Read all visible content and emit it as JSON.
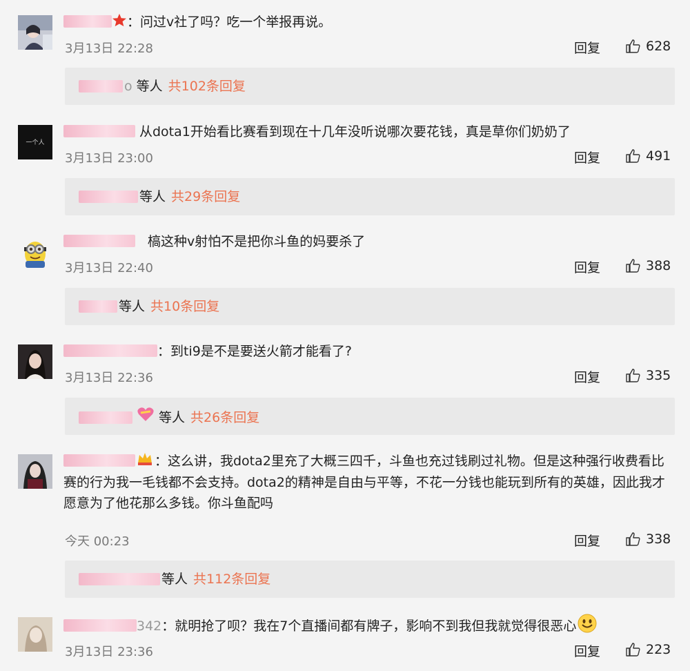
{
  "comments": [
    {
      "text": "：问过v社了吗？吃一个举报再说。",
      "time": "3月13日 22:28",
      "reply": "回复",
      "likes": "628",
      "sub_tail": "o",
      "sub_waiting": "等人",
      "sub_count": "共102条回复"
    },
    {
      "text": "从dota1开始看比赛看到现在十几年没听说哪次要花钱，真是草你们奶奶了",
      "time": "3月13日 23:00",
      "reply": "回复",
      "likes": "491",
      "sub_waiting": "等人",
      "sub_count": "共29条回复"
    },
    {
      "text": "槁这种v射怕不是把你斗鱼的妈要杀了",
      "time": "3月13日 22:40",
      "reply": "回复",
      "likes": "388",
      "sub_waiting": "等人",
      "sub_count": "共10条回复"
    },
    {
      "text": "：到ti9是不是要送火箭才能看了?",
      "time": "3月13日 22:36",
      "reply": "回复",
      "likes": "335",
      "sub_waiting": "等人",
      "sub_count": "共26条回复"
    },
    {
      "text": "：这么讲，我dota2里充了大概三四千，斗鱼也充过钱刷过礼物。但是这种强行收费看比赛的行为我一毛钱都不会支持。dota2的精神是自由与平等，不花一分钱也能玩到所有的英雄，因此我才愿意为了他花那么多钱。你斗鱼配吗",
      "time": "今天 00:23",
      "reply": "回复",
      "likes": "338",
      "sub_waiting": "等人",
      "sub_count": "共112条回复"
    },
    {
      "name_tail": "342",
      "text": "：就明抢了呗？我在7个直播间都有牌子，影响不到我但我就觉得很恶心",
      "time": "3月13日 23:36",
      "reply": "回复",
      "likes": "223"
    }
  ],
  "avatar2_text": "一个人",
  "icons": [
    "star-badge-icon",
    "thumb-up-icon",
    "heart-emoji-icon",
    "crown-badge-icon",
    "smile-emoji-icon"
  ],
  "colors": {
    "accent": "#eb7350",
    "background": "#f4f4f4",
    "subbox": "#e9e9e9",
    "meta": "#7a7a7a"
  }
}
